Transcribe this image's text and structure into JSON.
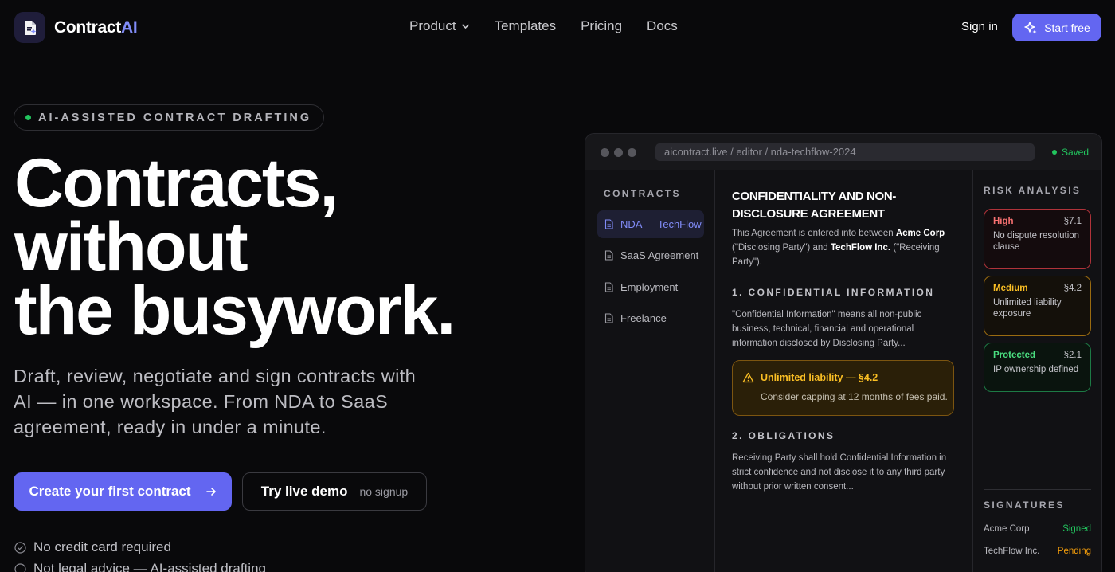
{
  "brand": {
    "name_main": "Contract",
    "name_accent": "AI",
    "accent_color": "#818cf8"
  },
  "nav": {
    "links": [
      "Product",
      "Templates",
      "Pricing",
      "Docs"
    ],
    "sign_in": "Sign in",
    "start_free": "Start free"
  },
  "hero": {
    "eyebrow": "AI-ASSISTED CONTRACT DRAFTING",
    "headline": [
      "Contracts,",
      "without",
      "the busywork."
    ],
    "subheadline": "Draft, review, negotiate and sign contracts with AI — in one workspace. From NDA to SaaS agreement, ready in under a minute.",
    "cta_primary": "Create your first contract",
    "cta_secondary": "Try live demo",
    "cta_secondary_note": "no signup",
    "checks": [
      "No credit card required",
      "Not legal advice — AI-assisted drafting"
    ]
  },
  "editor": {
    "url": "aicontract.live / editor / nda-techflow-2024",
    "status": "Saved",
    "sidebar": {
      "label": "CONTRACTS",
      "items": [
        "NDA — TechFlow Inc.",
        "SaaS Agreement",
        "Employment",
        "Freelance"
      ]
    },
    "document": {
      "title": "CONFIDENTIALITY AND NON-DISCLOSURE AGREEMENT",
      "intro": {
        "p1": "This Agreement is entered into between ",
        "party1": "Acme Corp",
        "p2": " (\"Disclosing Party\") and ",
        "party2": "TechFlow Inc.",
        "p3": " (\"Receiving Party\")."
      },
      "section1_heading": "1. CONFIDENTIAL INFORMATION",
      "section1_text": "\"Confidential Information\" means all non-public business, technical, financial and operational information disclosed by Disclosing Party...",
      "warning_title": "Unlimited liability — §4.2",
      "warning_text": "Consider capping at 12 months of fees paid.",
      "section2_heading": "2. OBLIGATIONS",
      "section2_text": "Receiving Party shall hold Confidential Information in strict confidence and not disclose it to any third party without prior written consent..."
    },
    "risk": {
      "label": "RISK ANALYSIS",
      "items": [
        {
          "level": "High",
          "section": "§7.1",
          "desc": "No dispute resolution clause"
        },
        {
          "level": "Medium",
          "section": "§4.2",
          "desc": "Unlimited liability exposure"
        },
        {
          "level": "Protected",
          "section": "§2.1",
          "desc": "IP ownership defined"
        }
      ]
    },
    "signatures": {
      "label": "SIGNATURES",
      "rows": [
        {
          "party": "Acme Corp",
          "status": "Signed"
        },
        {
          "party": "TechFlow Inc.",
          "status": "Pending"
        }
      ]
    }
  },
  "colors": {
    "primary": "#6366f1",
    "success": "#22c55e",
    "warning": "#f59e0b",
    "danger": "#f87171"
  }
}
